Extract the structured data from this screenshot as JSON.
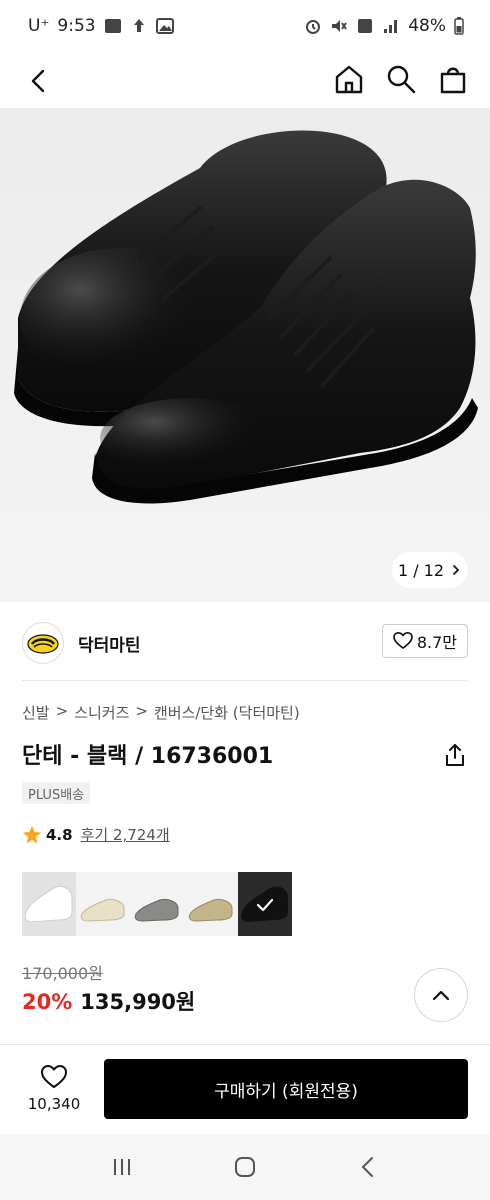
{
  "status_bar": {
    "carrier": "U⁺",
    "time": "9:53",
    "battery": "48%"
  },
  "nav": {
    "icons": [
      "back-icon",
      "home-icon",
      "search-icon",
      "bag-icon"
    ]
  },
  "gallery": {
    "counter": "1 / 12"
  },
  "brand": {
    "name": "닥터마틴",
    "likes": "8.7만"
  },
  "product": {
    "breadcrumb": [
      "신발",
      ">",
      "스니커즈",
      ">",
      "캔버스/단화 (닥터마틴)"
    ],
    "title": "단테 - 블랙 / 16736001",
    "badge": "PLUS배송",
    "rating": "4.8",
    "reviews": "후기 2,724개",
    "original_price": "170,000원",
    "discount": "20%",
    "sale_price": "135,990원"
  },
  "colors": {
    "swatch_fill": [
      "#ffffff",
      "#e8e1c8",
      "#8a8a86",
      "#c4b48a",
      "#1a1a1a"
    ],
    "accent_red": "#e8281f",
    "star_color": "#f5a623"
  },
  "bottom": {
    "wish_count": "10,340",
    "buy_label": "구매하기 (회원전용)"
  }
}
